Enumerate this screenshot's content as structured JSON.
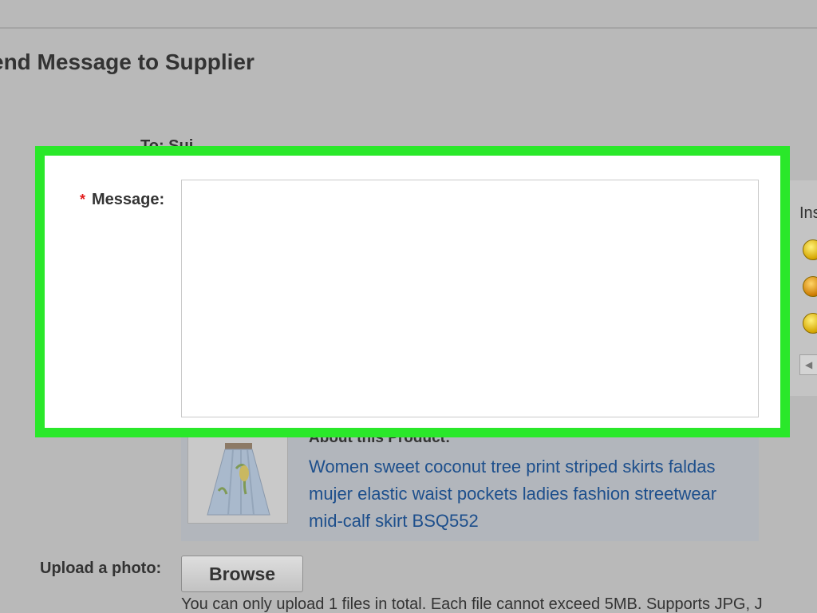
{
  "page": {
    "title": "end Message to Supplier",
    "to_label": "To: Sui..."
  },
  "message": {
    "label": "Message:",
    "required_marker": "*",
    "value": "",
    "placeholder": ""
  },
  "insert_panel": {
    "label": "Ins",
    "emoticons": [
      "smile-emoticon",
      "laugh-emoticon",
      "sleepy-emoticon"
    ]
  },
  "product": {
    "heading": "About this Product:",
    "link_text": "Women sweet coconut tree print striped skirts faldas mujer elastic waist pockets ladies fashion streetwear mid-calf skirt BSQ552"
  },
  "upload": {
    "label": "Upload a photo:",
    "browse_label": "Browse",
    "note": "You can only upload 1 files in total. Each file cannot exceed 5MB. Supports JPG, J"
  },
  "colors": {
    "highlight": "#2ae82a",
    "link": "#1d4f8c",
    "required": "#e21b1b"
  }
}
